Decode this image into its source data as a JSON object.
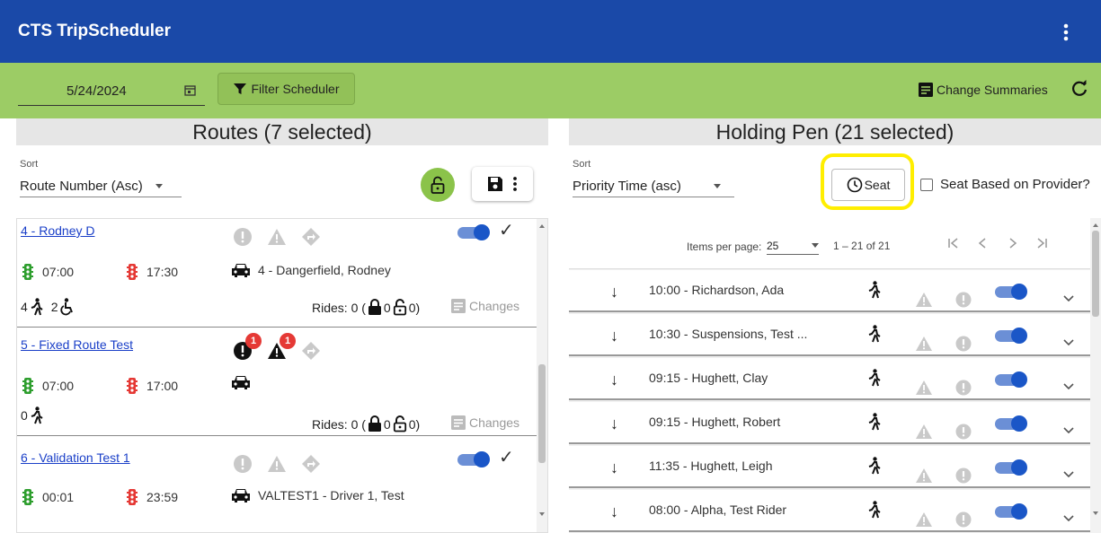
{
  "app": {
    "title": "CTS TripScheduler"
  },
  "toolbar": {
    "date": "5/24/2024",
    "filter_label": "Filter Scheduler",
    "change_summaries": "Change Summaries"
  },
  "routes_panel": {
    "title": "Routes (7 selected)",
    "sort_label": "Sort",
    "sort_value": "Route Number (Asc)",
    "routes": [
      {
        "name": "4 - Rodney D",
        "start": "07:00",
        "end": "17:30",
        "vehicle": "4 - Dangerfield, Rodney",
        "ambulatory": "4",
        "wheelchair": "2",
        "rides": "Rides: 0 (",
        "locked": "0",
        "unlocked": "0)",
        "changes": "Changes",
        "enabled": true
      },
      {
        "name": "5 - Fixed Route Test",
        "start": "07:00",
        "end": "17:00",
        "vehicle": "",
        "ambulatory": "0",
        "rides": "Rides: 0 (",
        "locked": "0",
        "unlocked": "0)",
        "changes": "Changes",
        "errors_badge": "1",
        "warnings_badge": "1"
      },
      {
        "name": "6 - Validation Test 1",
        "start": "00:01",
        "end": "23:59",
        "vehicle": "VALTEST1 - Driver 1, Test",
        "enabled": true
      }
    ]
  },
  "holding_panel": {
    "title": "Holding Pen (21 selected)",
    "sort_label": "Sort",
    "sort_value": "Priority Time (asc)",
    "seat_label": "Seat",
    "provider_label": "Seat Based on Provider?",
    "items_per_page_label": "Items per page:",
    "items_per_page": "25",
    "range": "1 – 21 of 21",
    "rides": [
      {
        "label": "10:00 - Richardson, Ada"
      },
      {
        "label": "10:30 - Suspensions, Test ..."
      },
      {
        "label": "09:15 - Hughett, Clay"
      },
      {
        "label": "09:15 - Hughett, Robert"
      },
      {
        "label": "11:35 - Hughett, Leigh"
      },
      {
        "label": "08:00 - Alpha, Test Rider"
      }
    ]
  },
  "colors": {
    "header": "#1a49a8",
    "toolbar": "#9ccc65",
    "toggle": "#1a56c7",
    "highlight": "#ffee00",
    "go_light": "#2e9e2e",
    "stop_light": "#e53935"
  }
}
